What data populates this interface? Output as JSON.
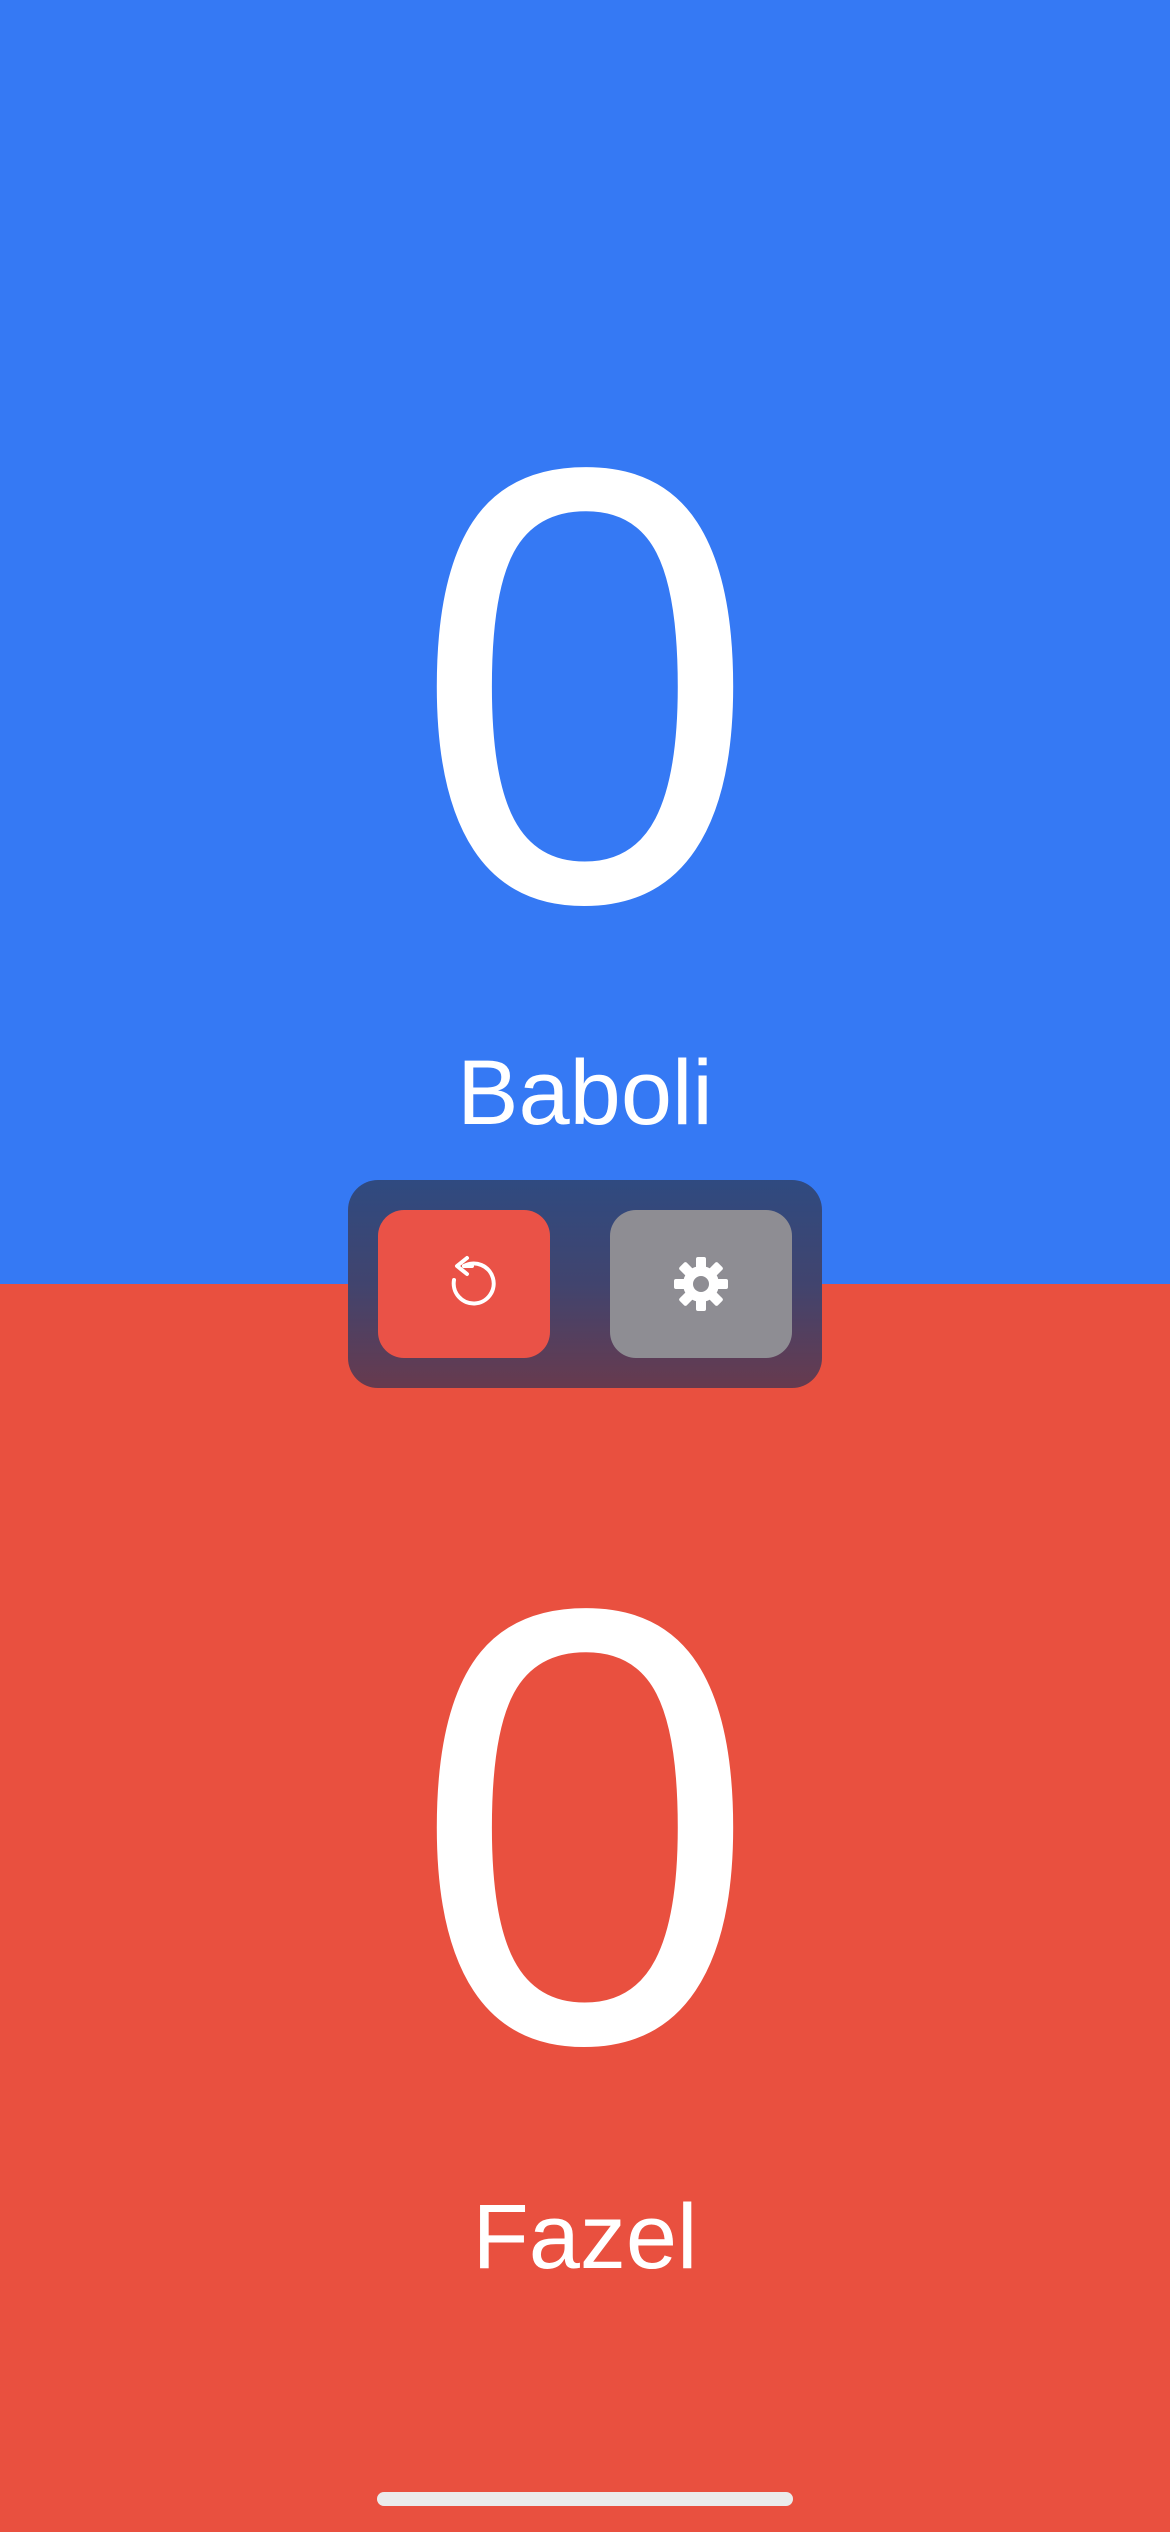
{
  "players": {
    "top": {
      "name": "Baboli",
      "score": "0",
      "color": "#3579F4"
    },
    "bottom": {
      "name": "Fazel",
      "score": "0",
      "color": "#E9503F"
    }
  },
  "controls": {
    "reset_icon": "reset-arrow-icon",
    "settings_icon": "gear-icon"
  },
  "colors": {
    "reset_button": "#EA5247",
    "settings_button": "#8E8D93",
    "text": "#FFFFFF"
  }
}
